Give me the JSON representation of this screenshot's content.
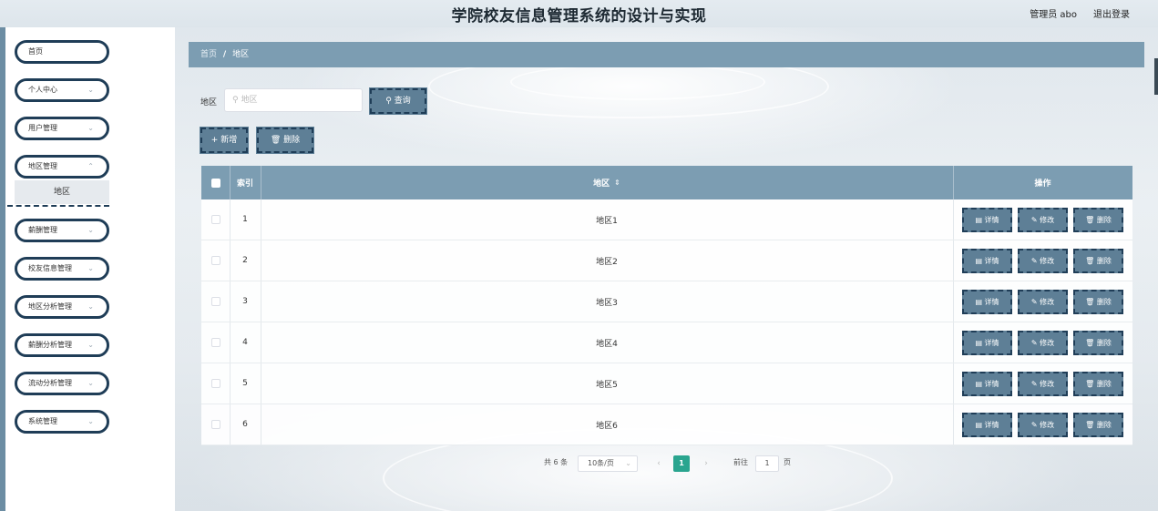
{
  "header": {
    "title": "学院校友信息管理系统的设计与实现",
    "user": "管理员 abo",
    "logout": "退出登录"
  },
  "sidebar": {
    "items": [
      {
        "label": "首页",
        "has_arrow": false
      },
      {
        "label": "个人中心",
        "has_arrow": true
      },
      {
        "label": "用户管理",
        "has_arrow": true
      },
      {
        "label": "地区管理",
        "has_arrow": true
      },
      {
        "label": "薪酬管理",
        "has_arrow": true
      },
      {
        "label": "校友信息管理",
        "has_arrow": true
      },
      {
        "label": "地区分析管理",
        "has_arrow": true
      },
      {
        "label": "薪酬分析管理",
        "has_arrow": true
      },
      {
        "label": "流动分析管理",
        "has_arrow": true
      },
      {
        "label": "系统管理",
        "has_arrow": true
      }
    ],
    "active_sub": "地区"
  },
  "breadcrumb": {
    "home": "首页",
    "separator": "/",
    "current": "地区"
  },
  "search": {
    "label": "地区",
    "placeholder": "地区",
    "query_button": "查询"
  },
  "actions": {
    "add": "新增",
    "delete": "删除"
  },
  "table": {
    "columns": [
      "索引",
      "地区",
      "操作"
    ],
    "rows": [
      {
        "index": "1",
        "region": "地区1"
      },
      {
        "index": "2",
        "region": "地区2"
      },
      {
        "index": "3",
        "region": "地区3"
      },
      {
        "index": "4",
        "region": "地区4"
      },
      {
        "index": "5",
        "region": "地区5"
      },
      {
        "index": "6",
        "region": "地区6"
      }
    ],
    "row_actions": {
      "detail": "详情",
      "edit": "修改",
      "delete": "删除"
    }
  },
  "pagination": {
    "total": "共 6 条",
    "page_size": "10条/页",
    "current_page": "1",
    "goto_label": "前往",
    "goto_value": "1",
    "page_unit": "页"
  },
  "colors": {
    "accent": "#7c9db2",
    "button": "#5e7f96",
    "border": "#1f3d57",
    "current_page": "#2aa58f"
  }
}
